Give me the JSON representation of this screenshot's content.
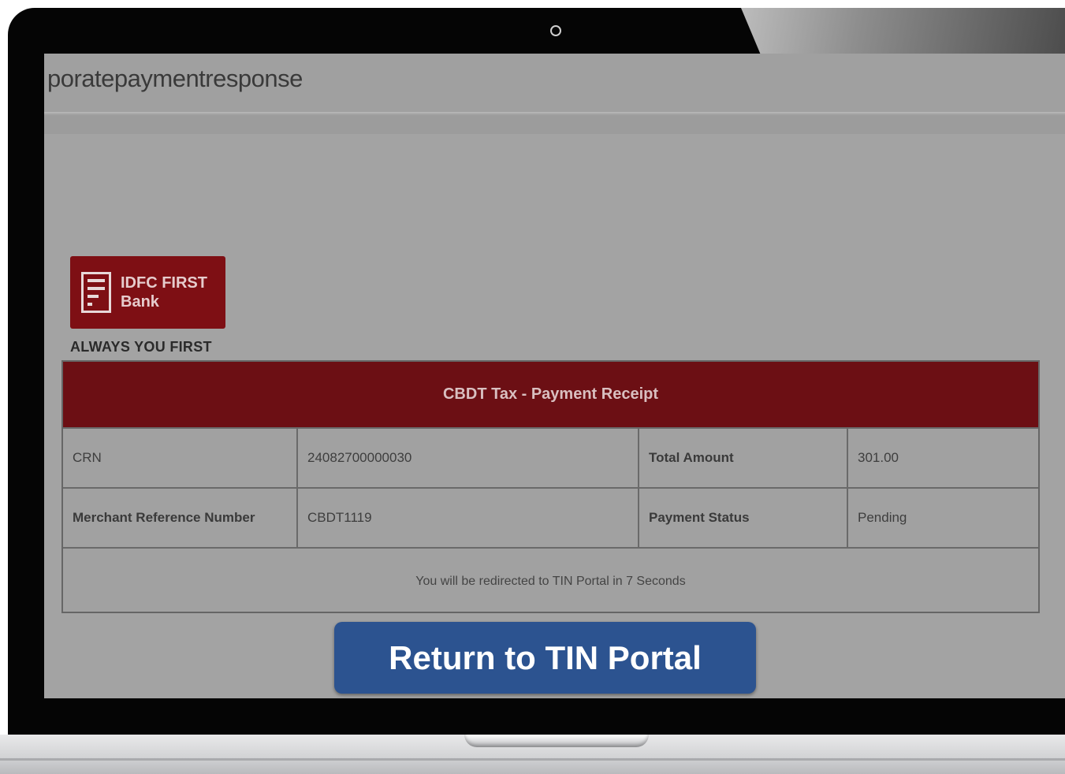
{
  "browser": {
    "url_fragment": "poratepaymentresponse"
  },
  "bank": {
    "logo_line1": "IDFC FIRST",
    "logo_line2": "Bank",
    "tagline": "ALWAYS YOU FIRST",
    "brand_color": "#7e0f14"
  },
  "receipt": {
    "title": "CBDT Tax - Payment Receipt",
    "rows": [
      {
        "label1": "CRN",
        "value1": "24082700000030",
        "label2": "Total Amount",
        "value2": "301.00"
      },
      {
        "label1": "Merchant Reference Number",
        "value1": "CBDT1119",
        "label2": "Payment Status",
        "value2": "Pending"
      }
    ],
    "redirect_text": "You will be redirected to TIN Portal in 7 Seconds"
  },
  "overlay_button": {
    "label": "Return to TIN Portal",
    "color": "#2c5390"
  }
}
